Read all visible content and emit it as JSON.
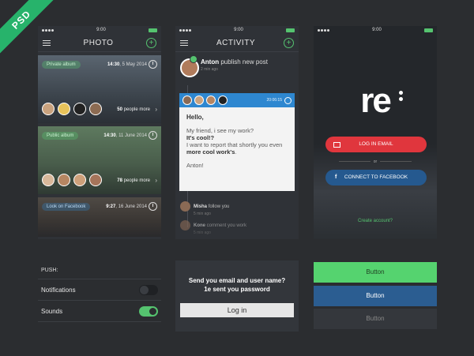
{
  "badge": "PSD",
  "status_time": "9:00",
  "photo": {
    "title": "PHOTO",
    "albums": [
      {
        "label": "Private album",
        "time": "14:30",
        "date": "5 May 2014",
        "people_count": "50",
        "people_suffix": "people more"
      },
      {
        "label": "Public album",
        "time": "14:30",
        "date": "11 June 2014",
        "people_count": "78",
        "people_suffix": "people more"
      },
      {
        "label": "Look on Facebook",
        "time": "9:27",
        "date": "16 June 2014"
      }
    ]
  },
  "activity": {
    "title": "ACTIVITY",
    "post_author": "Anton",
    "post_action": "publish new post",
    "post_time": "2 min ago",
    "card_time": "20:06:15",
    "card_greeting": "Hello,",
    "card_line1": "My friend, i see my work?",
    "card_line2": "It's cool!?",
    "card_line3": "I want to report that shortly you even",
    "card_line3_bold": "more cool work's",
    "card_line3_end": ".",
    "card_sign": "Anton!",
    "items": [
      {
        "name": "Misha",
        "action": "follow you",
        "time": "5 min ago"
      },
      {
        "name": "Kone",
        "action": "comment you work",
        "time": "5 min ago"
      }
    ]
  },
  "login_screen": {
    "logo": "re",
    "email_button": "LOG IN EMAIL",
    "or": "or",
    "facebook_button": "CONNECT TO FACEBOOK",
    "create_account": "Create account?"
  },
  "push": {
    "title": "PUSH:",
    "notifications": "Notifications",
    "sounds": "Sounds"
  },
  "login_panel": {
    "line1": "Send you email and user name?",
    "line2": "1e sent you password",
    "button": "Log in"
  },
  "buttons": {
    "green": "Button",
    "blue": "Button",
    "dark": "Button"
  },
  "colors": {
    "accent_green": "#55c36f",
    "red": "#e0363d",
    "blue": "#2e87d0",
    "facebook": "#25598f"
  }
}
